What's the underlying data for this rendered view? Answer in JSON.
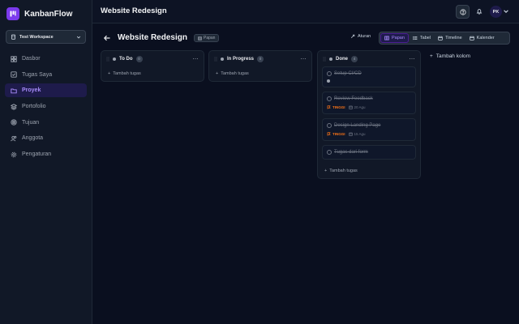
{
  "brand": {
    "name": "KanbanFlow",
    "logo_color": "#7c3aed"
  },
  "workspace": {
    "label": "Test Workspace"
  },
  "sidebar": {
    "items": [
      {
        "label": "Dasbor",
        "icon": "dashboard-icon",
        "active": false
      },
      {
        "label": "Tugas Saya",
        "icon": "checklist-icon",
        "active": false
      },
      {
        "label": "Proyek",
        "icon": "folder-icon",
        "active": true
      },
      {
        "label": "Portofolio",
        "icon": "layers-icon",
        "active": false
      },
      {
        "label": "Tujuan",
        "icon": "target-icon",
        "active": false
      },
      {
        "label": "Anggota",
        "icon": "users-icon",
        "active": false
      },
      {
        "label": "Pengaturan",
        "icon": "gear-icon",
        "active": false
      }
    ]
  },
  "header": {
    "title": "Website Redesign",
    "avatar_initials": "PK"
  },
  "board": {
    "title": "Website Redesign",
    "view_badge": "Papan",
    "settings_label": "Aturan",
    "views": [
      {
        "label": "Papan",
        "active": true
      },
      {
        "label": "Tabel",
        "active": false
      },
      {
        "label": "Timeline",
        "active": false
      },
      {
        "label": "Kalender",
        "active": false
      }
    ],
    "add_column_label": "Tambah kolom"
  },
  "columns": [
    {
      "name": "To Do",
      "count": "0",
      "dot_color": "#9ca3af",
      "add_label": "Tambah tugas",
      "cards": []
    },
    {
      "name": "In Progress",
      "count": "0",
      "dot_color": "#9ca3af",
      "add_label": "Tambah tugas",
      "cards": []
    },
    {
      "name": "Done",
      "count": "4",
      "dot_color": "#9ca3af",
      "add_label": "Tambah tugas",
      "cards": [
        {
          "title": "Setup CI/CD",
          "priority": "",
          "date": ""
        },
        {
          "title": "Review Feedback",
          "priority": "TINGGI",
          "date": "20 Agu"
        },
        {
          "title": "Design Landing Page",
          "priority": "TINGGI",
          "date": "15 Agu"
        },
        {
          "title": "Tugas dari form",
          "priority": "",
          "date": ""
        }
      ]
    }
  ],
  "colors": {
    "accent": "#a78bfa",
    "priority_high": "#f97316",
    "background": "#0a0f1f"
  }
}
